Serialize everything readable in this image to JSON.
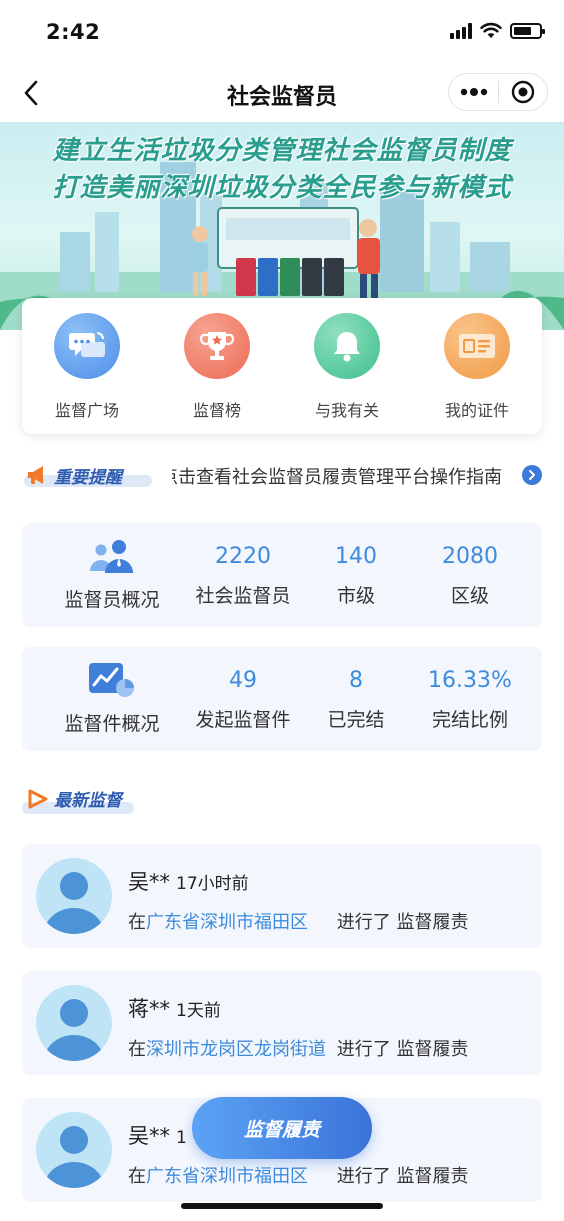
{
  "status_bar": {
    "time": "2:42",
    "battery_level": 0.7
  },
  "nav": {
    "title": "社会监督员",
    "back_icon": "chevron-left-icon",
    "more_icon": "more-dots-icon",
    "close_icon": "target-circle-icon"
  },
  "banner": {
    "line1": "建立生活垃圾分类管理社会监督员制度",
    "line2": "打造美丽深圳垃圾分类全民参与新模式"
  },
  "menu": {
    "items": [
      {
        "label": "监督广场",
        "icon": "chat-bubbles-icon",
        "color": "#4f8ee8"
      },
      {
        "label": "监督榜",
        "icon": "trophy-icon",
        "color": "#ec6b55"
      },
      {
        "label": "与我有关",
        "icon": "bell-icon",
        "color": "#3fbf8e"
      },
      {
        "label": "我的证件",
        "icon": "id-card-icon",
        "color": "#f29a45"
      }
    ]
  },
  "notice": {
    "tag": "重要提醒",
    "text": "点击查看社会监督员履责管理平台操作指南"
  },
  "overview": {
    "supervisors": {
      "title": "监督员概况",
      "stats": [
        {
          "value": "2220",
          "label": "社会监督员"
        },
        {
          "value": "140",
          "label": "市级"
        },
        {
          "value": "2080",
          "label": "区级"
        }
      ]
    },
    "cases": {
      "title": "监督件概况",
      "stats": [
        {
          "value": "49",
          "label": "发起监督件"
        },
        {
          "value": "8",
          "label": "已完结"
        },
        {
          "value": "16.33%",
          "label": "完结比例"
        }
      ]
    }
  },
  "latest": {
    "tag": "最新监督",
    "records": [
      {
        "name": "吴**",
        "time": "17小时前",
        "prefix": "在",
        "location": "广东省深圳市福田区",
        "action": "进行了 监督履责"
      },
      {
        "name": "蒋**",
        "time": "1天前",
        "prefix": "在",
        "location": "深圳市龙岗区龙岗街道",
        "action": "进行了 监督履责"
      },
      {
        "name": "吴**",
        "time": "1",
        "prefix": "在",
        "location": "广东省深圳市福田区",
        "action": "进行了 监督履责"
      }
    ]
  },
  "float_button": {
    "label": "监督履责"
  },
  "colors": {
    "accent": "#3e8bdc",
    "tag": "#2d5cb0",
    "card_bg": "#f3f7fd"
  }
}
